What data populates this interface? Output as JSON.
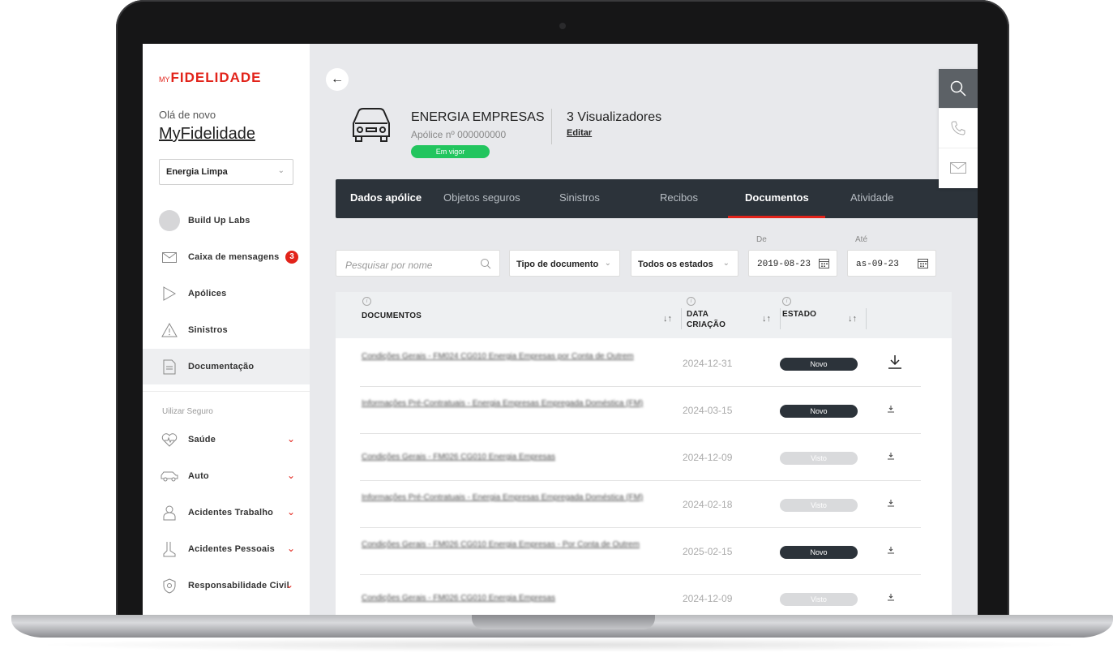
{
  "sidebar": {
    "logo_prefix": "MY",
    "logo_main": "FIDELIDADE",
    "greeting": "Olá de novo",
    "username": "MyFidelidade",
    "company_select": "Energia Limpa",
    "items": [
      {
        "label": "Build Up Labs",
        "icon": "avatar"
      },
      {
        "label": "Caixa de mensagens",
        "icon": "mail-icon",
        "badge": "3"
      },
      {
        "label": "Apólices",
        "icon": "policy-icon"
      },
      {
        "label": "Sinistros",
        "icon": "warning-icon"
      },
      {
        "label": "Documentação",
        "icon": "document-icon",
        "active": true
      }
    ],
    "section_label": "Uilizar Seguro",
    "insurance_items": [
      {
        "label": "Saúde",
        "icon": "heart-icon"
      },
      {
        "label": "Auto",
        "icon": "car-icon"
      },
      {
        "label": "Acidentes Trabalho",
        "icon": "worker-icon"
      },
      {
        "label": "Acidentes Pessoais",
        "icon": "foot-icon"
      },
      {
        "label": "Responsabilidade Civil",
        "icon": "shield-icon"
      }
    ]
  },
  "policy": {
    "title": "ENERGIA EMPRESAS",
    "number": "Apólice nº 000000000",
    "status": "Em vigor",
    "viewers": "3 Visualizadores",
    "edit": "Editar"
  },
  "tabs": [
    "Dados apólice",
    "Objetos seguros",
    "Sinistros",
    "Recibos",
    "Documentos",
    "Atividade"
  ],
  "active_tab": "Documentos",
  "filters": {
    "search_placeholder": "Pesquisar por nome",
    "doc_type": "Tipo de documento",
    "states": "Todos os estados",
    "from_label": "De",
    "from_value": "2019-08-23",
    "to_label": "Até",
    "to_value": "as-09-23"
  },
  "table": {
    "headers": {
      "documents": "DOCUMENTOS",
      "date_line1": "DATA",
      "date_line2": "CRIAÇÃO",
      "state": "ESTADO"
    },
    "rows": [
      {
        "name": "Condições Gerais - FM024 CG010 Energia Empresas por Conta de Outrem",
        "date": "2024-12-31",
        "status": "Novo"
      },
      {
        "name": "Informações Pré-Contratuais - Energia Empresas Empregada Doméstica (FM)",
        "date": "2024-03-15",
        "status": "Novo"
      },
      {
        "name": "Condições Gerais - FM026 CG010 Energia Empresas",
        "date": "2024-12-09",
        "status": "Visto"
      },
      {
        "name": "Informações Pré-Contratuais - Energia Empresas Empregada Doméstica (FM)",
        "date": "2024-02-18",
        "status": "Visto"
      },
      {
        "name": "Condições Gerais - FM026 CG010 Energia Empresas - Por Conta de Outrem",
        "date": "2025-02-15",
        "status": "Novo"
      },
      {
        "name": "Condições Gerais - FM026 CG010 Energia Empresas",
        "date": "2024-12-09",
        "status": "Visto"
      }
    ]
  },
  "colors": {
    "brand_red": "#e2231a",
    "tab_bg": "#2c333a",
    "status_green": "#22c55e"
  }
}
